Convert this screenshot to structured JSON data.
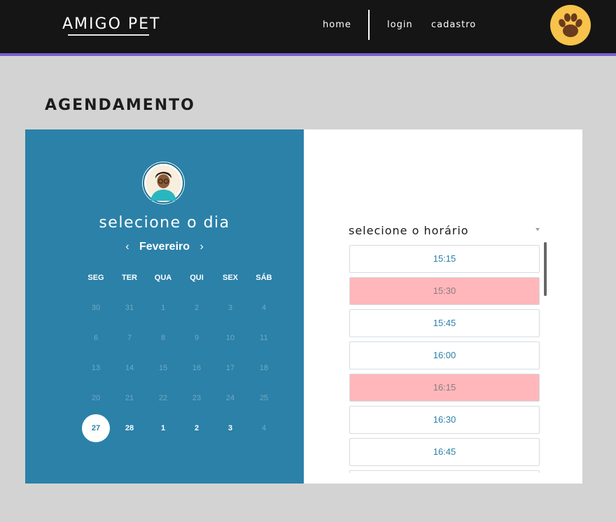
{
  "header": {
    "brand": "AMIGO PET",
    "nav": {
      "home": "home",
      "login": "login",
      "signup": "cadastro"
    },
    "logo_icon": "paw-icon"
  },
  "page": {
    "title": "AGENDAMENTO"
  },
  "calendar": {
    "heading": "selecione o dia",
    "month": "Fevereiro",
    "prev_symbol": "‹",
    "next_symbol": "›",
    "weekdays": [
      "SEG",
      "TER",
      "QUA",
      "QUI",
      "SEX",
      "SÁB"
    ],
    "weeks": [
      [
        "30",
        "31",
        "1",
        "2",
        "3",
        "4"
      ],
      [
        "6",
        "7",
        "8",
        "9",
        "10",
        "11"
      ],
      [
        "13",
        "14",
        "15",
        "16",
        "17",
        "18"
      ],
      [
        "20",
        "21",
        "22",
        "23",
        "24",
        "25"
      ],
      [
        "27",
        "28",
        "1",
        "2",
        "3",
        "4"
      ]
    ],
    "selected_day": "27",
    "colors": {
      "panel": "#2b81a8"
    }
  },
  "time": {
    "heading": "selecione o horário",
    "slots": [
      "15:15",
      "15:30",
      "15:45",
      "16:00",
      "16:15",
      "16:30",
      "16:45"
    ],
    "unavailable": [
      "15:30",
      "16:15"
    ],
    "colors": {
      "available_text": "#2b81a8",
      "unavailable_bg": "#ffb7bb"
    }
  }
}
